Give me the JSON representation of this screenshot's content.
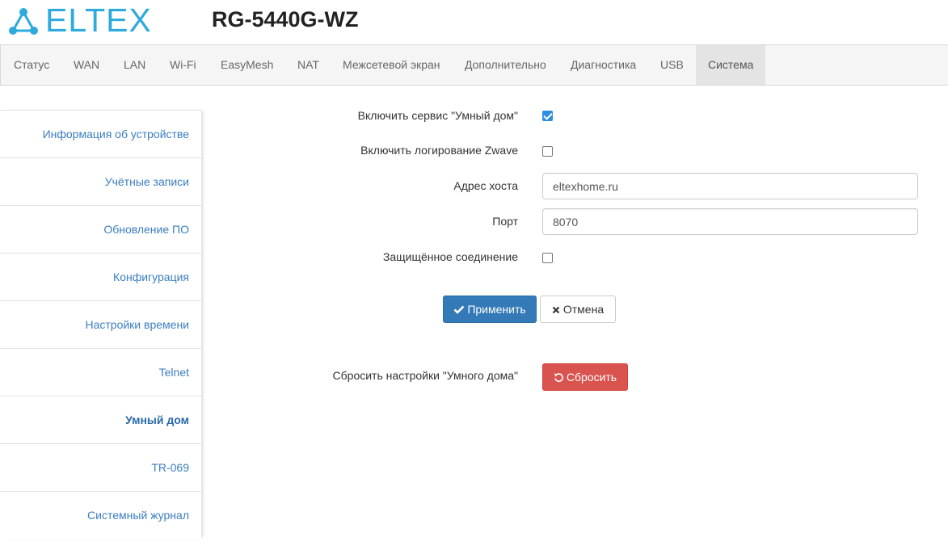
{
  "header": {
    "logo_text": "ELTEX",
    "model": "RG-5440G-WZ"
  },
  "nav": {
    "items": [
      "Статус",
      "WAN",
      "LAN",
      "Wi-Fi",
      "EasyMesh",
      "NAT",
      "Межсетевой экран",
      "Дополнительно",
      "Диагностика",
      "USB",
      "Система"
    ],
    "active": "Система"
  },
  "sidebar": {
    "items": [
      "Информация об устройстве",
      "Учётные записи",
      "Обновление ПО",
      "Конфигурация",
      "Настройки времени",
      "Telnet",
      "Умный дом",
      "TR-069",
      "Системный журнал"
    ],
    "active": "Умный дом"
  },
  "form": {
    "enable_service_label": "Включить сервис \"Умный дом\"",
    "enable_service_checked": true,
    "enable_zwave_label": "Включить логирование Zwave",
    "enable_zwave_checked": false,
    "host_label": "Адрес хоста",
    "host_value": "eltexhome.ru",
    "port_label": "Порт",
    "port_value": "8070",
    "secure_label": "Защищённое соединение",
    "secure_checked": false,
    "apply_label": "Применить",
    "cancel_label": "Отмена",
    "reset_label_text": "Сбросить настройки \"Умного дома\"",
    "reset_button_label": "Сбросить"
  },
  "colors": {
    "brand": "#2eaadc",
    "primary": "#337ab7",
    "danger": "#d9534f",
    "link": "#3a7ec0"
  }
}
